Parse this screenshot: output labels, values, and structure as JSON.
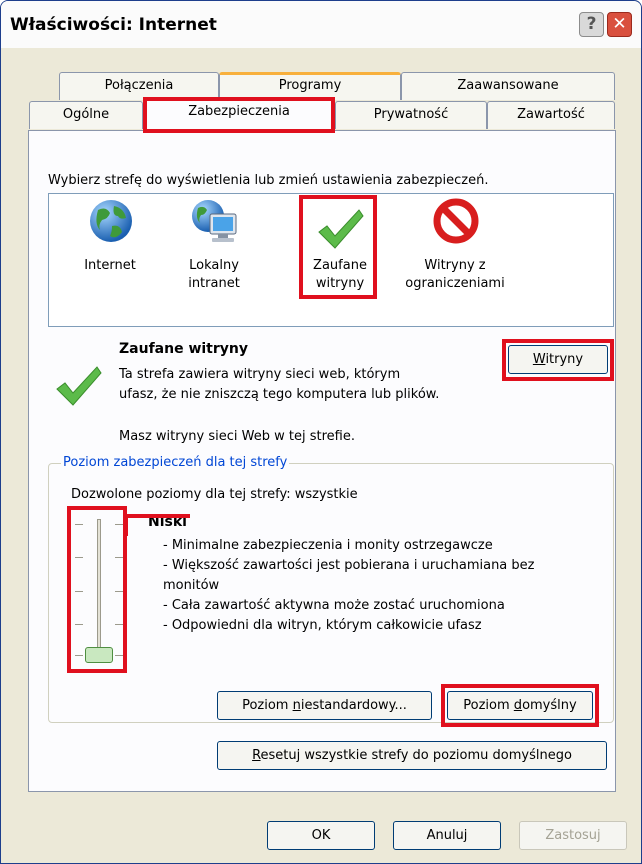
{
  "window": {
    "title": "Właściwości: Internet",
    "help_glyph": "?",
    "close_glyph": "✕"
  },
  "tabs_row1": [
    {
      "label": "Połączenia"
    },
    {
      "label": "Programy"
    },
    {
      "label": "Zaawansowane"
    }
  ],
  "tabs_row2": [
    {
      "label": "Ogólne"
    },
    {
      "label": "Zabezpieczenia",
      "active": true
    },
    {
      "label": "Prywatność"
    },
    {
      "label": "Zawartość"
    }
  ],
  "security": {
    "prompt": "Wybierz strefę do wyświetlenia lub zmień ustawienia zabezpieczeń.",
    "zones": [
      {
        "line1": "Internet",
        "line2": "",
        "icon": "globe-icon"
      },
      {
        "line1": "Lokalny",
        "line2": "intranet",
        "icon": "intranet-computer-icon"
      },
      {
        "line1": "Zaufane",
        "line2": "witryny",
        "icon": "checkmark-icon",
        "selected": true
      },
      {
        "line1": "Witryny z",
        "line2": "ograniczeniami",
        "icon": "restricted-icon"
      }
    ],
    "zone_title": "Zaufane witryny",
    "zone_desc_line1": "Ta strefa zawiera witryny sieci web, którym",
    "zone_desc_line2": "ufasz, że nie zniszczą tego komputera lub plików.",
    "zone_note": "Masz witryny sieci Web w tej strefie.",
    "sites_button": {
      "prefix": "",
      "accel": "W",
      "rest": "itryny"
    }
  },
  "level": {
    "group_title": "Poziom zabezpieczeń dla tej strefy",
    "allowed": "Dozwolone poziomy dla tej strefy: wszystkie",
    "level_name": "Niski",
    "slider_position": "bottom (Niski)",
    "bullets": [
      "- Minimalne zabezpieczenia i monity ostrzegawcze",
      "- Większość zawartości jest pobierana i uruchamiana bez",
      "monitów",
      "- Cała zawartość aktywna może zostać uruchomiona",
      "- Odpowiedni dla witryn, którym całkowicie ufasz"
    ],
    "custom_button": {
      "prefix": "Poziom ",
      "accel": "n",
      "rest": "iestandardowy..."
    },
    "default_button": {
      "prefix": "Poziom ",
      "accel": "d",
      "rest": "omyślny"
    },
    "reset_button": {
      "prefix": "",
      "accel": "R",
      "rest": "esetuj wszystkie strefy do poziomu domyślnego"
    }
  },
  "footer": {
    "ok": "OK",
    "cancel": "Anuluj",
    "apply": "Zastosuj"
  },
  "colors": {
    "highlight": "#e0101e",
    "accent_tab": "#f8b03c",
    "group_title": "#0046d5"
  }
}
